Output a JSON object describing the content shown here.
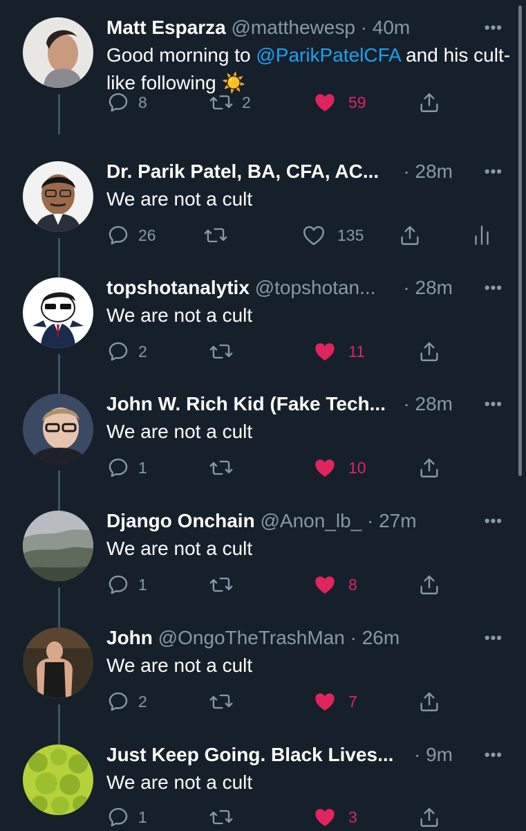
{
  "tweets": [
    {
      "name": "Matt Esparza",
      "handle": "@matthewesp",
      "dot": "·",
      "time": "40m",
      "time_right": "",
      "body_prefix": "Good morning to ",
      "body_mention": "@ParikPatelCFA",
      "body_suffix": " and his cult-like following ☀️",
      "replies": "8",
      "retweets": "2",
      "likes": "59",
      "liked": true,
      "show_analytics": false,
      "avatar": "man-profile-photo"
    },
    {
      "name": "Dr. Parik Patel, BA, CFA, AC...",
      "handle": "",
      "dot": "",
      "time": "",
      "time_right": "· 28m",
      "body_prefix": "We are not a cult",
      "body_mention": "",
      "body_suffix": "",
      "replies": "26",
      "retweets": "",
      "likes": "135",
      "liked": false,
      "show_analytics": true,
      "avatar": "man-glasses-photo"
    },
    {
      "name": "topshotanalytix",
      "handle": "@topshotan...",
      "dot": "",
      "time": "",
      "time_right": "· 28m",
      "body_prefix": "We are not a cult",
      "body_mention": "",
      "body_suffix": "",
      "replies": "2",
      "retweets": "",
      "likes": "11",
      "liked": true,
      "show_analytics": false,
      "avatar": "cartoon-businessman"
    },
    {
      "name": "John W. Rich Kid (Fake Tech...",
      "handle": "",
      "dot": "",
      "time": "",
      "time_right": "· 28m",
      "body_prefix": "We are not a cult",
      "body_mention": "",
      "body_suffix": "",
      "replies": "1",
      "retweets": "",
      "likes": "10",
      "liked": true,
      "show_analytics": false,
      "avatar": "young-man-glasses-photo"
    },
    {
      "name": "Django Onchain",
      "handle": "@Anon_lb_",
      "dot": "·",
      "time": "27m",
      "time_right": "",
      "body_prefix": "We are not a cult",
      "body_mention": "",
      "body_suffix": "",
      "replies": "1",
      "retweets": "",
      "likes": "8",
      "liked": true,
      "show_analytics": false,
      "avatar": "landscape-photo"
    },
    {
      "name": "John",
      "handle": "@OngoTheTrashMan",
      "dot": "·",
      "time": "26m",
      "time_right": "",
      "body_prefix": "We are not a cult",
      "body_mention": "",
      "body_suffix": "",
      "replies": "2",
      "retweets": "",
      "likes": "7",
      "liked": true,
      "show_analytics": false,
      "avatar": "man-tank-top-photo"
    },
    {
      "name": "Just Keep Going. Black Lives...",
      "handle": "",
      "dot": "",
      "time": "",
      "time_right": "· 9m",
      "body_prefix": "We are not a cult",
      "body_mention": "",
      "body_suffix": "",
      "replies": "1",
      "retweets": "",
      "likes": "3",
      "liked": true,
      "show_analytics": false,
      "avatar": "romanesco-photo"
    }
  ],
  "icons": {
    "reply": "reply-icon",
    "retweet": "retweet-icon",
    "like": "heart-icon",
    "share": "share-icon",
    "more": "more-icon",
    "analytics": "analytics-icon"
  },
  "colors": {
    "background": "#15202b",
    "text": "#ffffff",
    "secondary": "#8899a6",
    "mention": "#1da1f2",
    "like": "#e0245e",
    "thread_line": "#3d5466"
  }
}
